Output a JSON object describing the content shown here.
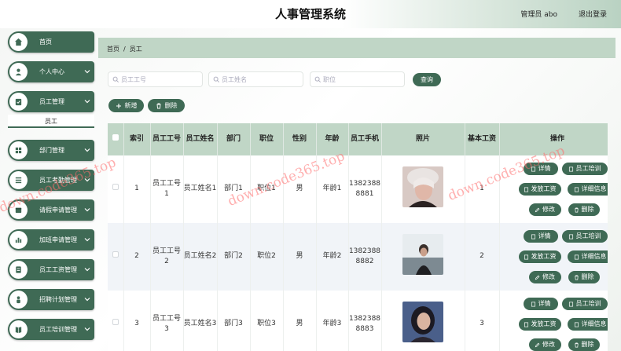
{
  "header": {
    "title": "人事管理系统",
    "admin_label": "管理员 abo",
    "logout_label": "退出登录"
  },
  "sidebar": {
    "items": [
      {
        "label": "首页",
        "icon": "home-icon"
      },
      {
        "label": "个人中心",
        "icon": "user-icon"
      },
      {
        "label": "员工管理",
        "icon": "clipboard-icon"
      },
      {
        "label": "部门管理",
        "icon": "grid-icon"
      },
      {
        "label": "员工考勤管理",
        "icon": "list-icon"
      },
      {
        "label": "请假申请管理",
        "icon": "calendar-icon"
      },
      {
        "label": "加班申请管理",
        "icon": "bar-chart-icon"
      },
      {
        "label": "员工工资管理",
        "icon": "document-icon"
      },
      {
        "label": "招聘计划管理",
        "icon": "person-icon"
      },
      {
        "label": "员工培训管理",
        "icon": "book-icon"
      }
    ],
    "sub_item": "员工"
  },
  "breadcrumb": {
    "home": "首页",
    "separator": "/",
    "current": "员工"
  },
  "search": {
    "placeholder_id": "员工工号",
    "placeholder_name": "员工姓名",
    "placeholder_position": "职位",
    "button": "查询"
  },
  "toolbar": {
    "add": "新增",
    "delete": "删除"
  },
  "table": {
    "headers": [
      "索引",
      "员工工号",
      "员工姓名",
      "部门",
      "职位",
      "性别",
      "年龄",
      "员工手机",
      "照片",
      "基本工资",
      "操作"
    ],
    "rows": [
      {
        "index": "1",
        "emp_id": "员工工号1",
        "name": "员工姓名1",
        "dept": "部门1",
        "position": "职位1",
        "gender": "男",
        "age": "年龄1",
        "phone": "13823888881",
        "salary": "1"
      },
      {
        "index": "2",
        "emp_id": "员工工号2",
        "name": "员工姓名2",
        "dept": "部门2",
        "position": "职位2",
        "gender": "男",
        "age": "年龄2",
        "phone": "13823888882",
        "salary": "2"
      },
      {
        "index": "3",
        "emp_id": "员工工号3",
        "name": "员工姓名3",
        "dept": "部门3",
        "position": "职位3",
        "gender": "男",
        "age": "年龄3",
        "phone": "13823888883",
        "salary": "3"
      }
    ],
    "actions": {
      "detail": "详情",
      "training": "员工培训",
      "pay": "发放工资",
      "detail_info": "详细信息",
      "edit": "修改",
      "delete": "删除"
    }
  },
  "watermark": "down.code365.top",
  "colors": {
    "primary": "#3f6a55",
    "header_bg": "#c0d6c6"
  }
}
